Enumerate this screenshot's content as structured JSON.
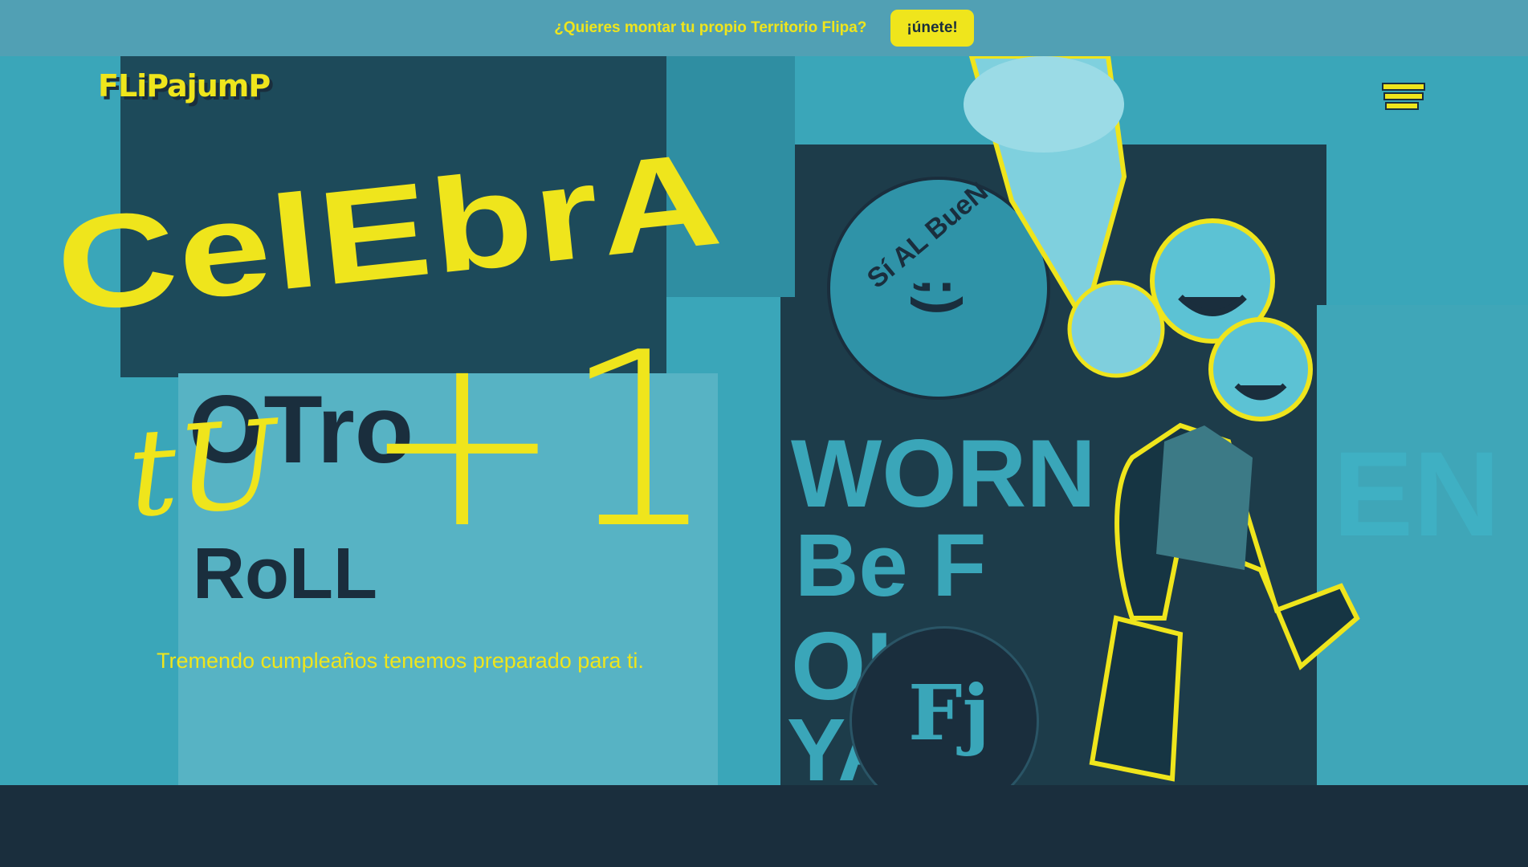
{
  "topbar": {
    "promo_text": "¿Quieres montar tu propio Territorio Flipa?",
    "cta_label": "¡únete!"
  },
  "header": {
    "logo_text": "FLiPajumP",
    "menu_icon": "menu-icon"
  },
  "hero": {
    "headline_line1": "CelEbrA",
    "headline_line2": "tU",
    "headline_plus_one": "+1",
    "tagline": "Tremendo cumpleaños tenemos preparado para ti.",
    "poster_words": {
      "otro": "OTro",
      "roll": "RoLL",
      "worn": "WORN",
      "be": "Be F",
      "oh": "OH",
      "ya": "YA",
      "en": "EN",
      "circle_text": "Sí AL BueN",
      "circle_face": ";)",
      "badge_text": "Fj"
    }
  },
  "colors": {
    "accent": "#efe51c",
    "dark": "#1a2e3d",
    "teal": "#3aa6b9",
    "topbar": "#51a0b4"
  }
}
